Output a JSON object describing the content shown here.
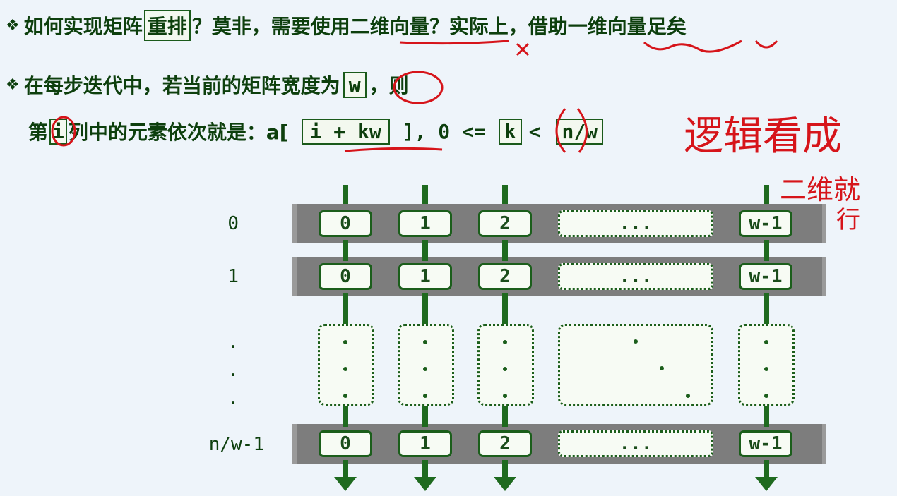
{
  "bullet_symbol": "❖",
  "line1": {
    "pre": "如何实现矩阵",
    "boxed": "重排",
    "post": "？莫非，需要使用二维向量？实际上，借助一维向量足矣"
  },
  "line2": {
    "pre": "在每步迭代中，若当前的矩阵宽度为",
    "boxed": "w",
    "post": "，则"
  },
  "line3": {
    "pre": "第",
    "boxed_i": "i",
    "mid": "列中的元素依次就是：a[",
    "boxed_expr": "i + kw",
    "after_expr": "], 0 <=",
    "boxed_k": "k",
    "lt": "<",
    "boxed_nw": "n/w"
  },
  "rows": {
    "labels": [
      "0",
      "1",
      "n/w-1"
    ],
    "dots": "."
  },
  "cells": [
    "0",
    "1",
    "2",
    "...",
    "w-1"
  ],
  "vertical_dots": "·",
  "handwriting": {
    "note1": "逻辑看成",
    "note2": "二维就",
    "note3": "行"
  },
  "colors": {
    "accent": "#1b5e1b",
    "ink": "#d6141a",
    "scroll": "#7d7d7d"
  }
}
